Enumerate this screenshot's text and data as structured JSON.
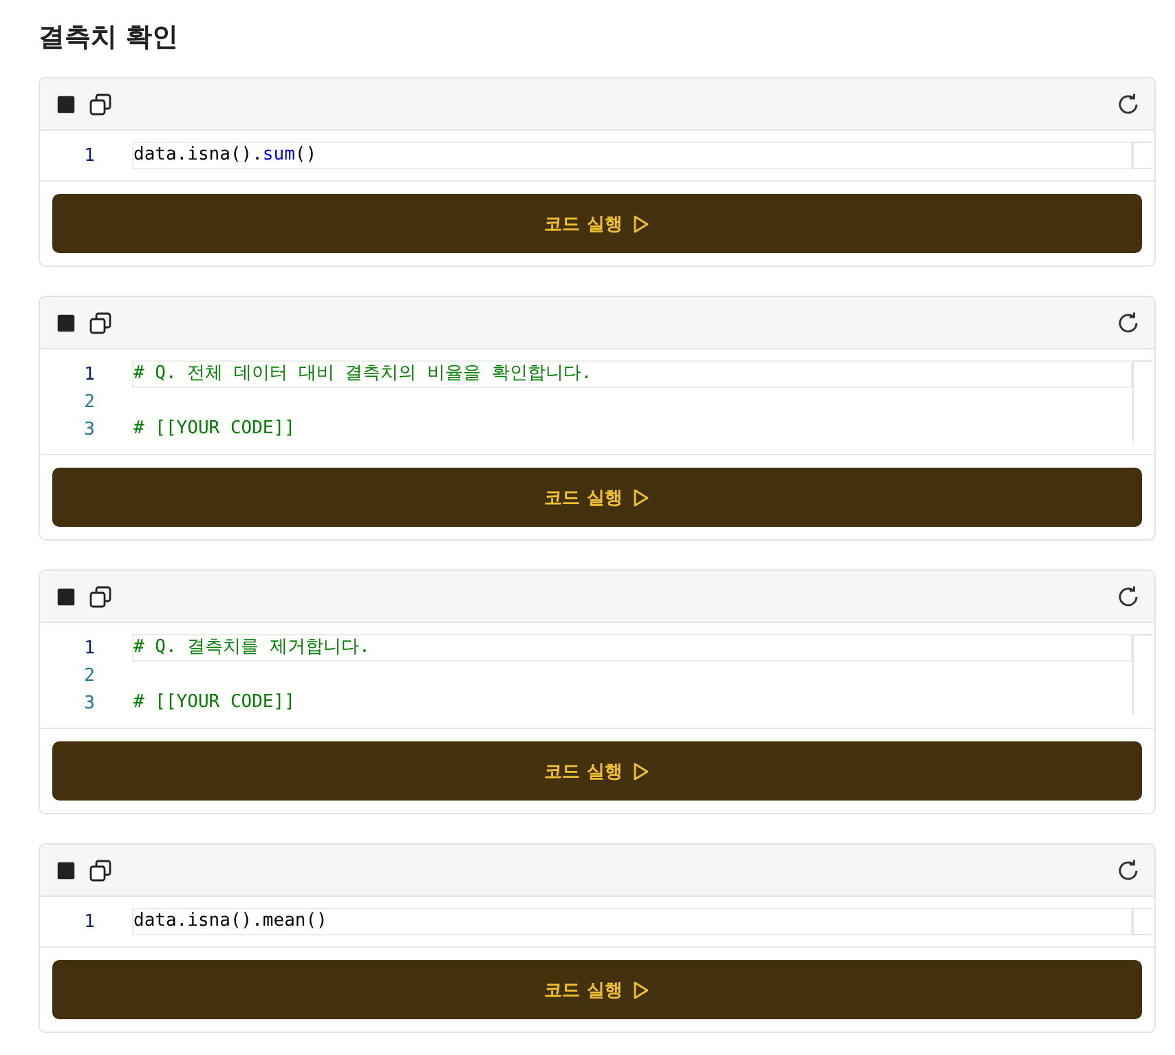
{
  "heading": "결측치 확인",
  "cells": [
    {
      "lines": [
        {
          "number": "1",
          "active": true,
          "tokens": [
            {
              "text": "data.isna().",
              "kind": "plain"
            },
            {
              "text": "sum",
              "kind": "builtin"
            },
            {
              "text": "()",
              "kind": "plain"
            }
          ]
        }
      ],
      "run_label": "코드 실행"
    },
    {
      "lines": [
        {
          "number": "1",
          "active": true,
          "tokens": [
            {
              "text": "# Q. 전체 데이터 대비 결측치의 비율을 확인합니다.",
              "kind": "comment"
            }
          ]
        },
        {
          "number": "2",
          "active": false
        },
        {
          "number": "3",
          "active": false,
          "tokens": [
            {
              "text": "# [[YOUR CODE]]",
              "kind": "comment"
            }
          ]
        }
      ],
      "run_label": "코드 실행"
    },
    {
      "lines": [
        {
          "number": "1",
          "active": true,
          "tokens": [
            {
              "text": "# Q. 결측치를 제거합니다.",
              "kind": "comment"
            }
          ]
        },
        {
          "number": "2",
          "active": false
        },
        {
          "number": "3",
          "active": false,
          "tokens": [
            {
              "text": "# [[YOUR CODE]]",
              "kind": "comment"
            }
          ]
        }
      ],
      "run_label": "코드 실행"
    },
    {
      "lines": [
        {
          "number": "1",
          "active": true,
          "tokens": [
            {
              "text": "data.isna().mean()",
              "kind": "plain"
            }
          ]
        }
      ],
      "run_label": "코드 실행"
    }
  ]
}
